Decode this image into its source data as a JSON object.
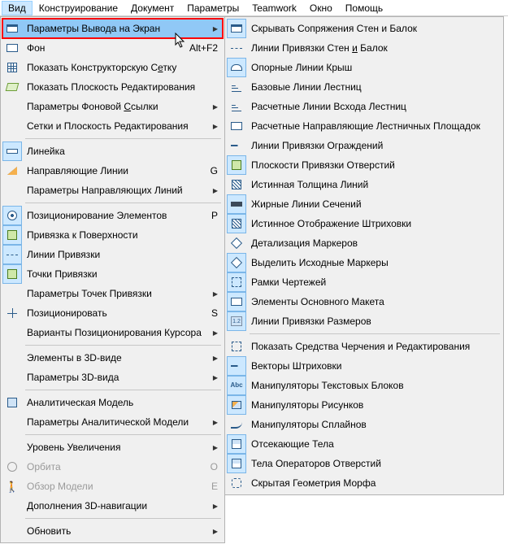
{
  "menubar": {
    "items": [
      {
        "label": "Вид",
        "active": true
      },
      {
        "label": "Конструирование"
      },
      {
        "label": "Документ"
      },
      {
        "label": "Параметры"
      },
      {
        "label": "Teamwork"
      },
      {
        "label": "Окно"
      },
      {
        "label": "Помощь"
      }
    ]
  },
  "dropdown": {
    "items": [
      {
        "label": "Параметры Вывода на Экран",
        "icon": "window",
        "submenu": true,
        "highlight": true
      },
      {
        "label": "Фон",
        "icon": "rect",
        "shortcut": "Alt+F2"
      },
      {
        "label": "Показать Конструкторскую Сетку",
        "icon": "grid",
        "u": 26
      },
      {
        "label": "Показать Плоскость Редактирования",
        "icon": "plane"
      },
      {
        "label": "Параметры Фоновой Ссылки",
        "submenu": true,
        "u": 18
      },
      {
        "label": "Сетки и Плоскость Редактирования",
        "submenu": true
      },
      {
        "sep": true
      },
      {
        "label": "Линейка",
        "icon": "ruler",
        "toggled": true
      },
      {
        "label": "Направляющие Линии",
        "icon": "tri",
        "shortcut": "G"
      },
      {
        "label": "Параметры Направляющих Линий",
        "submenu": true
      },
      {
        "sep": true
      },
      {
        "label": "Позиционирование Элементов",
        "icon": "target",
        "shortcut": "P",
        "toggled": true
      },
      {
        "label": "Привязка к Поверхности",
        "icon": "snap",
        "toggled": true
      },
      {
        "label": "Линии Привязки",
        "icon": "dash",
        "toggled": true
      },
      {
        "label": "Точки Привязки",
        "icon": "check",
        "toggled": true
      },
      {
        "label": "Параметры Точек Привязки",
        "submenu": true
      },
      {
        "label": "Позиционировать",
        "icon": "crosshair",
        "shortcut": "S"
      },
      {
        "label": "Варианты Позиционирования Курсора",
        "submenu": true
      },
      {
        "sep": true
      },
      {
        "label": "Элементы в 3D-виде",
        "submenu": true
      },
      {
        "label": "Параметры 3D-вида",
        "submenu": true
      },
      {
        "sep": true
      },
      {
        "label": "Аналитическая Модель",
        "icon": "3d"
      },
      {
        "label": "Параметры Аналитической Модели",
        "submenu": true
      },
      {
        "sep": true
      },
      {
        "label": "Уровень Увеличения",
        "submenu": true
      },
      {
        "label": "Орбита",
        "icon": "orbit",
        "shortcut": "O",
        "disabled": true
      },
      {
        "label": "Обзор Модели",
        "icon": "person",
        "shortcut": "E",
        "disabled": true
      },
      {
        "label": "Дополнения 3D-навигации",
        "submenu": true
      },
      {
        "sep": true
      },
      {
        "label": "Обновить",
        "submenu": true
      }
    ]
  },
  "submenu": {
    "items": [
      {
        "label": "Скрывать Сопряжения Стен и Балок",
        "icon": "window",
        "toggled": true
      },
      {
        "label": "Линии Привязки Стен и Балок",
        "icon": "dash",
        "u": 20
      },
      {
        "label": "Опорные Линии Крыш",
        "icon": "roof",
        "toggled": true
      },
      {
        "label": "Базовые Линии Лестниц",
        "icon": "stair"
      },
      {
        "label": "Расчетные Линии Всхода Лестниц",
        "icon": "stair"
      },
      {
        "label": "Расчетные Направляющие Лестничных Площадок",
        "icon": "rect"
      },
      {
        "label": "Линии Привязки Ограждений",
        "icon": "vec"
      },
      {
        "label": "Плоскости Привязки Отверстий",
        "icon": "snap",
        "toggled": true
      },
      {
        "label": "Истинная Толщина Линий",
        "icon": "hatch"
      },
      {
        "label": "Жирные Линии Сечений",
        "icon": "thick",
        "toggled": true
      },
      {
        "label": "Истинное Отображение Штриховки",
        "icon": "hatch",
        "toggled": true
      },
      {
        "label": "Детализация Маркеров",
        "icon": "diamond"
      },
      {
        "label": "Выделить Исходные Маркеры",
        "icon": "diamond",
        "toggled": true
      },
      {
        "label": "Рамки Чертежей",
        "icon": "frame",
        "toggled": true
      },
      {
        "label": "Элементы Основного Макета",
        "icon": "rect",
        "toggled": true
      },
      {
        "label": "Линии Привязки Размеров",
        "icon": "num",
        "toggled": true
      },
      {
        "sep": true
      },
      {
        "label": "Показать Средства Черчения и Редактирования",
        "icon": "frame"
      },
      {
        "label": "Векторы Штриховки",
        "icon": "vec",
        "toggled": true
      },
      {
        "label": "Манипуляторы Текстовых Блоков",
        "icon": "abc",
        "toggled": true
      },
      {
        "label": "Манипуляторы Рисунков",
        "icon": "pic",
        "toggled": true
      },
      {
        "label": "Манипуляторы Сплайнов",
        "icon": "spline"
      },
      {
        "label": "Отсекающие Тела",
        "icon": "cut",
        "toggled": true
      },
      {
        "label": "Тела Операторов Отверстий",
        "icon": "cut",
        "toggled": true
      },
      {
        "label": "Скрытая Геометрия Морфа",
        "icon": "morph"
      }
    ]
  }
}
